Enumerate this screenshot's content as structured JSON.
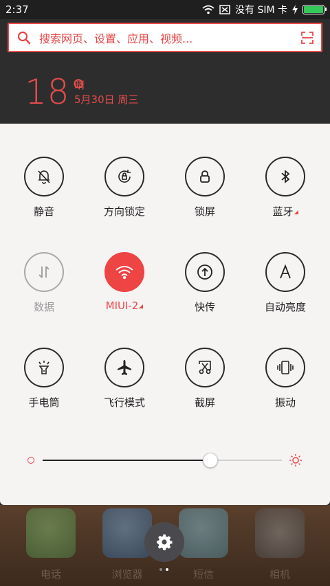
{
  "status_bar": {
    "time": "2:37",
    "carrier": "没有 SIM 卡",
    "battery_fraction": 1.0,
    "battery_color": "#34c759"
  },
  "search": {
    "placeholder": "搜索网页、设置、应用、视频...",
    "icons": [
      "search-icon",
      "scan-icon"
    ]
  },
  "weather": {
    "temperature": "18°",
    "condition": "晴",
    "date": "5月30日 周三"
  },
  "quick_settings": {
    "tiles": [
      {
        "label": "静音",
        "icon": "bell-off-icon",
        "state": "off"
      },
      {
        "label": "方向锁定",
        "icon": "rotation-lock-icon",
        "state": "off"
      },
      {
        "label": "锁屏",
        "icon": "lock-icon",
        "state": "off"
      },
      {
        "label": "蓝牙",
        "icon": "bluetooth-icon",
        "state": "off",
        "expandable": true
      },
      {
        "label": "数据",
        "icon": "data-icon",
        "state": "disabled"
      },
      {
        "label": "MIUI-2",
        "icon": "wifi-icon",
        "state": "on",
        "expandable": true
      },
      {
        "label": "快传",
        "icon": "transfer-icon",
        "state": "off"
      },
      {
        "label": "自动亮度",
        "icon": "auto-brightness-icon",
        "state": "off"
      },
      {
        "label": "手电筒",
        "icon": "flashlight-icon",
        "state": "off"
      },
      {
        "label": "飞行模式",
        "icon": "airplane-icon",
        "state": "off"
      },
      {
        "label": "截屏",
        "icon": "screenshot-icon",
        "state": "off"
      },
      {
        "label": "振动",
        "icon": "vibrate-icon",
        "state": "off"
      }
    ],
    "brightness": {
      "level": 0.7,
      "icons": [
        "brightness-min-icon",
        "brightness-max-icon"
      ]
    },
    "accent_color": "#ee4444"
  },
  "dock": {
    "apps": [
      {
        "label": "电话",
        "icon": "phone-icon"
      },
      {
        "label": "浏览器",
        "icon": "browser-icon"
      },
      {
        "label": "短信",
        "icon": "messages-icon"
      },
      {
        "label": "相机",
        "icon": "camera-icon"
      }
    ],
    "settings_icon": "gear-icon",
    "pages": 2,
    "current_page": 1
  }
}
